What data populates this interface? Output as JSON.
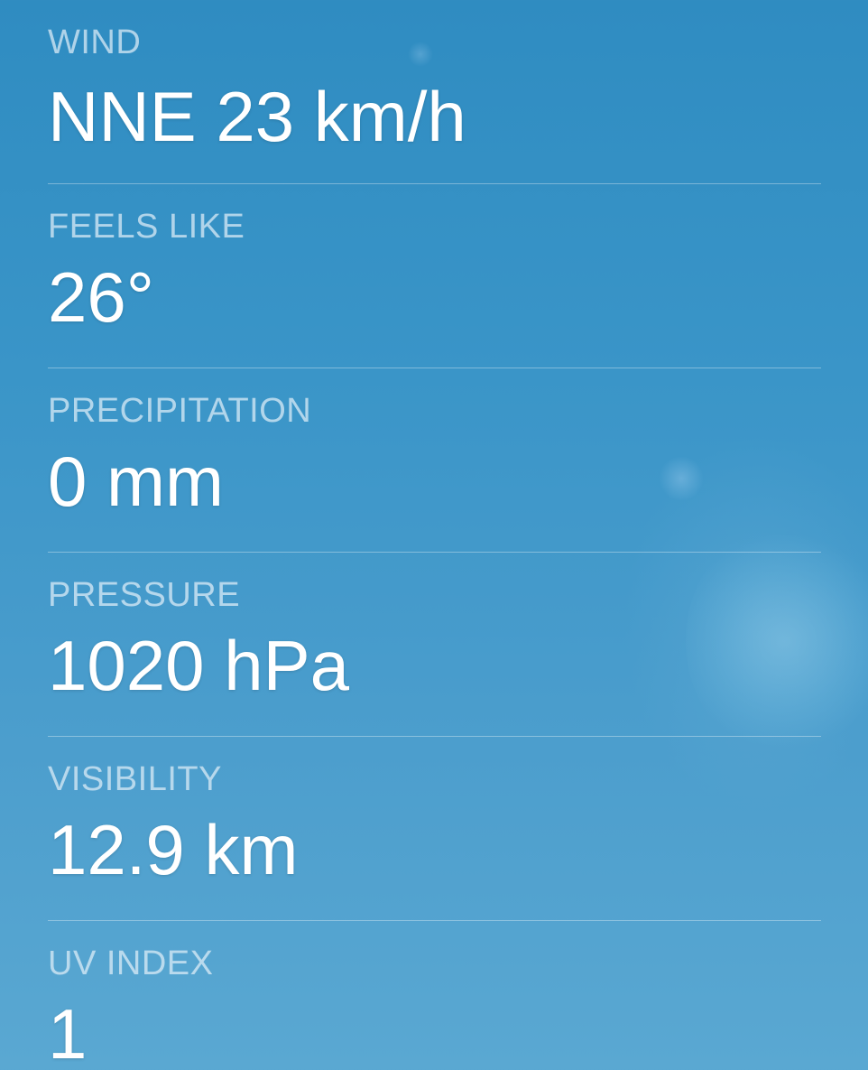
{
  "details": [
    {
      "label": "WIND",
      "value": "NNE 23 km/h"
    },
    {
      "label": "FEELS LIKE",
      "value": "26°"
    },
    {
      "label": "PRECIPITATION",
      "value": "0 mm"
    },
    {
      "label": "PRESSURE",
      "value": "1020 hPa"
    },
    {
      "label": "VISIBILITY",
      "value": "12.9 km"
    },
    {
      "label": "UV INDEX",
      "value": "1"
    }
  ],
  "colors": {
    "background_top": "#2f8cc1",
    "background_bottom": "#5aa8d2",
    "label": "#e1eef8",
    "value": "#ffffff"
  }
}
